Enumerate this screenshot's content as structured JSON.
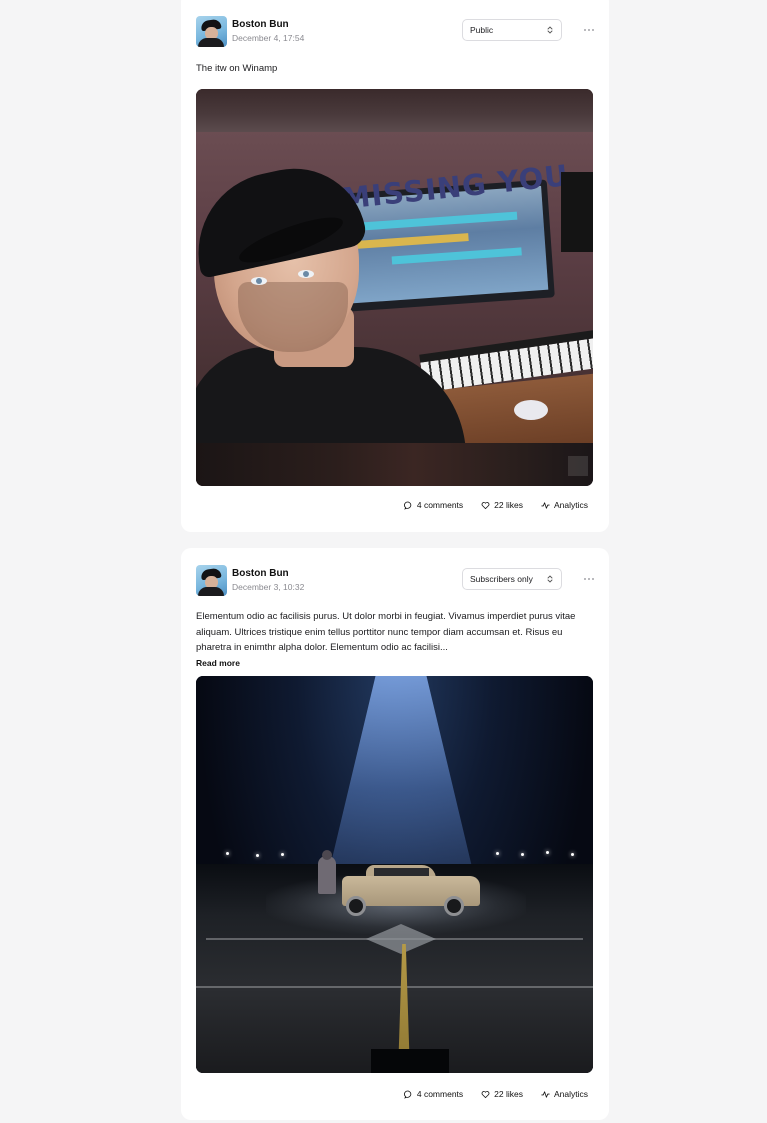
{
  "posts": [
    {
      "author": "Boston Bun",
      "date": "December 4, 17:54",
      "visibility": "Public",
      "caption": "The itw on Winamp",
      "image_text": "MISSING YOU",
      "comments": "4 comments",
      "likes": "22 likes",
      "analytics": "Analytics"
    },
    {
      "author": "Boston Bun",
      "date": "December 3, 10:32",
      "visibility": "Subscribers only",
      "caption": "Elementum odio ac facilisis purus. Ut dolor morbi in feugiat. Vivamus imperdiet purus vitae aliquam. Ultrices tristique enim tellus porttitor nunc tempor diam accumsan et. Risus eu pharetra in enimthr alpha dolor. Elementum odio ac facilisi...",
      "read_more": "Read more",
      "comments": "4 comments",
      "likes": "22 likes",
      "analytics": "Analytics"
    }
  ],
  "icons": {
    "visibility_select": "chevron-up-down-icon",
    "more": "more-horizontal-icon",
    "comments": "comment-icon",
    "likes": "heart-icon",
    "analytics": "activity-icon"
  }
}
